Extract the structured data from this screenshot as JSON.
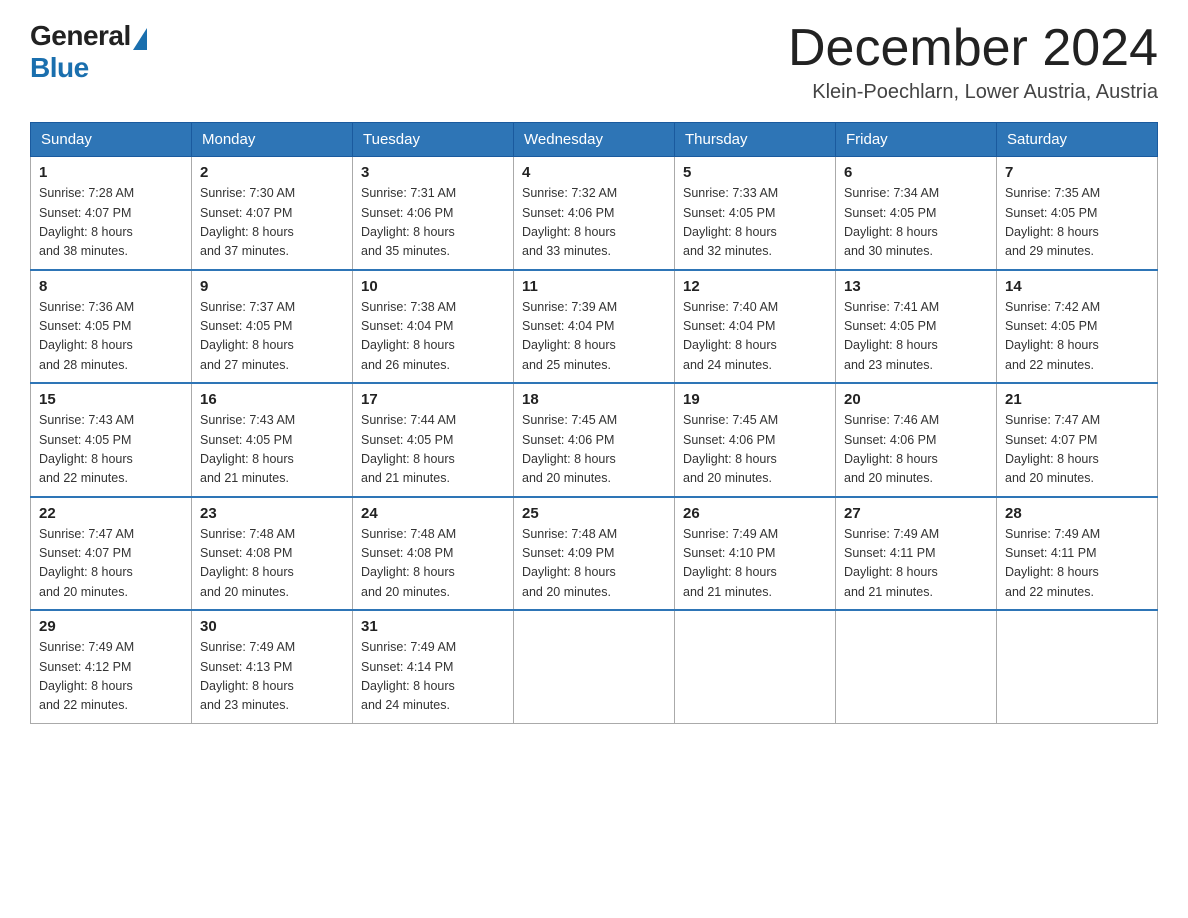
{
  "logo": {
    "general": "General",
    "blue": "Blue"
  },
  "title": "December 2024",
  "subtitle": "Klein-Poechlarn, Lower Austria, Austria",
  "weekdays": [
    "Sunday",
    "Monday",
    "Tuesday",
    "Wednesday",
    "Thursday",
    "Friday",
    "Saturday"
  ],
  "weeks": [
    [
      {
        "day": "1",
        "sunrise": "7:28 AM",
        "sunset": "4:07 PM",
        "daylight": "8 hours and 38 minutes."
      },
      {
        "day": "2",
        "sunrise": "7:30 AM",
        "sunset": "4:07 PM",
        "daylight": "8 hours and 37 minutes."
      },
      {
        "day": "3",
        "sunrise": "7:31 AM",
        "sunset": "4:06 PM",
        "daylight": "8 hours and 35 minutes."
      },
      {
        "day": "4",
        "sunrise": "7:32 AM",
        "sunset": "4:06 PM",
        "daylight": "8 hours and 33 minutes."
      },
      {
        "day": "5",
        "sunrise": "7:33 AM",
        "sunset": "4:05 PM",
        "daylight": "8 hours and 32 minutes."
      },
      {
        "day": "6",
        "sunrise": "7:34 AM",
        "sunset": "4:05 PM",
        "daylight": "8 hours and 30 minutes."
      },
      {
        "day": "7",
        "sunrise": "7:35 AM",
        "sunset": "4:05 PM",
        "daylight": "8 hours and 29 minutes."
      }
    ],
    [
      {
        "day": "8",
        "sunrise": "7:36 AM",
        "sunset": "4:05 PM",
        "daylight": "8 hours and 28 minutes."
      },
      {
        "day": "9",
        "sunrise": "7:37 AM",
        "sunset": "4:05 PM",
        "daylight": "8 hours and 27 minutes."
      },
      {
        "day": "10",
        "sunrise": "7:38 AM",
        "sunset": "4:04 PM",
        "daylight": "8 hours and 26 minutes."
      },
      {
        "day": "11",
        "sunrise": "7:39 AM",
        "sunset": "4:04 PM",
        "daylight": "8 hours and 25 minutes."
      },
      {
        "day": "12",
        "sunrise": "7:40 AM",
        "sunset": "4:04 PM",
        "daylight": "8 hours and 24 minutes."
      },
      {
        "day": "13",
        "sunrise": "7:41 AM",
        "sunset": "4:05 PM",
        "daylight": "8 hours and 23 minutes."
      },
      {
        "day": "14",
        "sunrise": "7:42 AM",
        "sunset": "4:05 PM",
        "daylight": "8 hours and 22 minutes."
      }
    ],
    [
      {
        "day": "15",
        "sunrise": "7:43 AM",
        "sunset": "4:05 PM",
        "daylight": "8 hours and 22 minutes."
      },
      {
        "day": "16",
        "sunrise": "7:43 AM",
        "sunset": "4:05 PM",
        "daylight": "8 hours and 21 minutes."
      },
      {
        "day": "17",
        "sunrise": "7:44 AM",
        "sunset": "4:05 PM",
        "daylight": "8 hours and 21 minutes."
      },
      {
        "day": "18",
        "sunrise": "7:45 AM",
        "sunset": "4:06 PM",
        "daylight": "8 hours and 20 minutes."
      },
      {
        "day": "19",
        "sunrise": "7:45 AM",
        "sunset": "4:06 PM",
        "daylight": "8 hours and 20 minutes."
      },
      {
        "day": "20",
        "sunrise": "7:46 AM",
        "sunset": "4:06 PM",
        "daylight": "8 hours and 20 minutes."
      },
      {
        "day": "21",
        "sunrise": "7:47 AM",
        "sunset": "4:07 PM",
        "daylight": "8 hours and 20 minutes."
      }
    ],
    [
      {
        "day": "22",
        "sunrise": "7:47 AM",
        "sunset": "4:07 PM",
        "daylight": "8 hours and 20 minutes."
      },
      {
        "day": "23",
        "sunrise": "7:48 AM",
        "sunset": "4:08 PM",
        "daylight": "8 hours and 20 minutes."
      },
      {
        "day": "24",
        "sunrise": "7:48 AM",
        "sunset": "4:08 PM",
        "daylight": "8 hours and 20 minutes."
      },
      {
        "day": "25",
        "sunrise": "7:48 AM",
        "sunset": "4:09 PM",
        "daylight": "8 hours and 20 minutes."
      },
      {
        "day": "26",
        "sunrise": "7:49 AM",
        "sunset": "4:10 PM",
        "daylight": "8 hours and 21 minutes."
      },
      {
        "day": "27",
        "sunrise": "7:49 AM",
        "sunset": "4:11 PM",
        "daylight": "8 hours and 21 minutes."
      },
      {
        "day": "28",
        "sunrise": "7:49 AM",
        "sunset": "4:11 PM",
        "daylight": "8 hours and 22 minutes."
      }
    ],
    [
      {
        "day": "29",
        "sunrise": "7:49 AM",
        "sunset": "4:12 PM",
        "daylight": "8 hours and 22 minutes."
      },
      {
        "day": "30",
        "sunrise": "7:49 AM",
        "sunset": "4:13 PM",
        "daylight": "8 hours and 23 minutes."
      },
      {
        "day": "31",
        "sunrise": "7:49 AM",
        "sunset": "4:14 PM",
        "daylight": "8 hours and 24 minutes."
      },
      null,
      null,
      null,
      null
    ]
  ],
  "labels": {
    "sunrise": "Sunrise:",
    "sunset": "Sunset:",
    "daylight": "Daylight:"
  }
}
